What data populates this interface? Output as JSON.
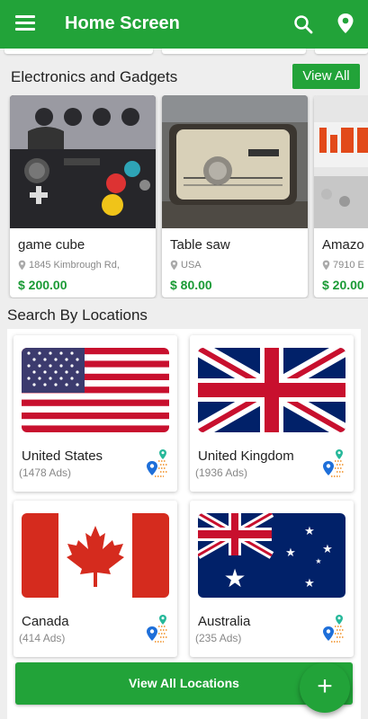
{
  "appbar": {
    "title": "Home Screen",
    "icons": [
      "menu-icon",
      "search-icon",
      "location-pin-icon"
    ]
  },
  "electronics": {
    "title": "Electronics and Gadgets",
    "view_all": "View All",
    "products": [
      {
        "name": "game cube",
        "location": "1845 Kimbrough Rd,",
        "price": "$ 200.00"
      },
      {
        "name": "Table saw",
        "location": "USA",
        "price": "$ 80.00"
      },
      {
        "name": "Amazo",
        "location": "7910 E",
        "price": "$ 20.00"
      }
    ]
  },
  "locations": {
    "title": "Search By Locations",
    "items": [
      {
        "name": "United States",
        "ads": "(1478 Ads)"
      },
      {
        "name": "United Kingdom",
        "ads": "(1936 Ads)"
      },
      {
        "name": "Canada",
        "ads": "(414 Ads)"
      },
      {
        "name": "Australia",
        "ads": "(235  Ads)"
      }
    ],
    "view_all": "View All Locations"
  },
  "fab": {
    "label": "+"
  },
  "colors": {
    "primary": "#22a339",
    "price": "#1a9a35"
  }
}
